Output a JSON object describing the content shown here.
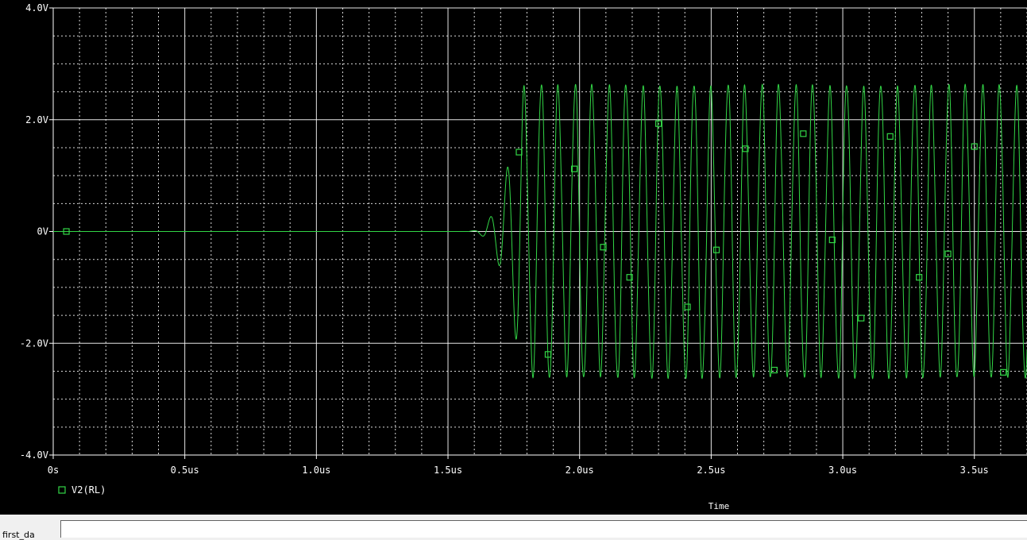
{
  "colors": {
    "background": "#000000",
    "grid": "#ffffff",
    "trace": "#32d646",
    "text": "#ffffff"
  },
  "chart_data": {
    "type": "line",
    "xlabel": "Time",
    "ylabel": "",
    "xlim": [
      0,
      3.7
    ],
    "ylim": [
      -4.0,
      4.0
    ],
    "x_unit": "us",
    "x_ticks": [
      0,
      0.5,
      1.0,
      1.5,
      2.0,
      2.5,
      3.0,
      3.5
    ],
    "x_tick_labels": [
      "0s",
      "0.5us",
      "1.0us",
      "1.5us",
      "2.0us",
      "2.5us",
      "3.0us",
      "3.5us"
    ],
    "y_ticks": [
      4.0,
      2.0,
      0,
      -2.0,
      -4.0
    ],
    "y_tick_labels": [
      "4.0V",
      "2.0V",
      "0V",
      "-2.0V",
      "-4.0V"
    ],
    "grid": true,
    "legend": "bottom-left",
    "series": [
      {
        "name": "V2(RL)",
        "color": "#32d646",
        "marker": "square",
        "period_us": 0.0645,
        "amplitude": 2.6,
        "onset_us": 1.58,
        "saturation_us": 1.78,
        "markers": [
          {
            "x": 0.05,
            "y": 0.0
          },
          {
            "x": 1.77,
            "y": 1.42
          },
          {
            "x": 1.88,
            "y": -2.2
          },
          {
            "x": 1.98,
            "y": 1.12
          },
          {
            "x": 2.09,
            "y": -0.28
          },
          {
            "x": 2.19,
            "y": -0.82
          },
          {
            "x": 2.3,
            "y": 1.93
          },
          {
            "x": 2.41,
            "y": -1.35
          },
          {
            "x": 2.52,
            "y": -0.33
          },
          {
            "x": 2.63,
            "y": 1.48
          },
          {
            "x": 2.74,
            "y": -2.48
          },
          {
            "x": 2.85,
            "y": 1.75
          },
          {
            "x": 2.96,
            "y": -0.15
          },
          {
            "x": 3.07,
            "y": -1.55
          },
          {
            "x": 3.18,
            "y": 1.7
          },
          {
            "x": 3.29,
            "y": -0.82
          },
          {
            "x": 3.4,
            "y": -0.4
          },
          {
            "x": 3.5,
            "y": 1.52
          },
          {
            "x": 3.61,
            "y": -2.52
          }
        ]
      }
    ]
  },
  "status": {
    "label": "first_da"
  }
}
